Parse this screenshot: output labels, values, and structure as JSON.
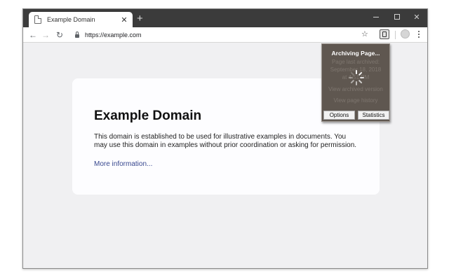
{
  "tab": {
    "title": "Example Domain",
    "close": "✕",
    "new_tab": "+"
  },
  "window_controls": {
    "close": "✕"
  },
  "toolbar": {
    "back": "←",
    "forward": "→",
    "reload": "↻",
    "url": "https://example.com",
    "bookmark": "☆"
  },
  "page": {
    "heading": "Example Domain",
    "paragraph": "This domain is established to be used for illustrative examples in documents. You may use this domain in examples without prior coordination or asking for permission.",
    "link": "More information..."
  },
  "popup": {
    "title": "Archiving Page...",
    "last_archived_label": "Page last archived:",
    "last_archived_date": "September 18, 2018",
    "last_archived_time": "at 4:51 PM",
    "view_archived": "View archived version",
    "view_history": "View page history",
    "options_button": "Options",
    "statistics_button": "Statistics"
  },
  "colors": {
    "titlebar": "#3b3b3b",
    "page_bg": "#f0f0f2",
    "popup_bg": "#5f5750",
    "link": "#38488f"
  }
}
